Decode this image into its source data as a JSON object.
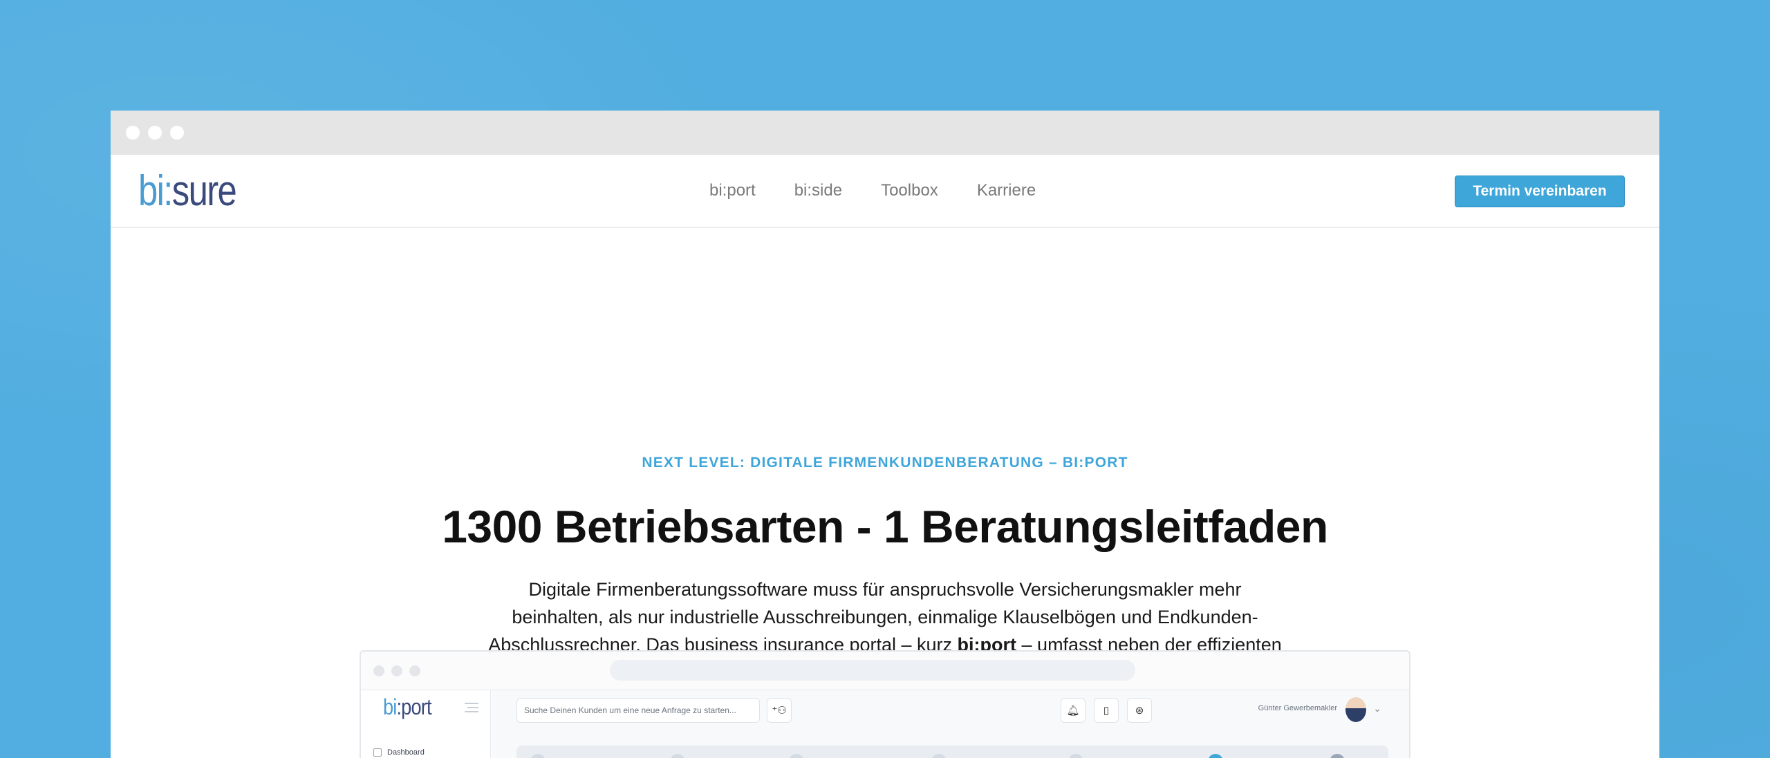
{
  "header": {
    "logo": {
      "bi": "bi",
      "colon": ":",
      "sure": "sure"
    },
    "nav": [
      "bi:port",
      "bi:side",
      "Toolbox",
      "Karriere"
    ],
    "cta_label": "Termin vereinbaren"
  },
  "hero": {
    "eyebrow": "NEXT LEVEL: DIGITALE FIRMENKUNDENBERATUNG – BI:PORT",
    "headline": "1300 Betriebsarten - 1 Beratungsleitfaden",
    "desc_before": "Digitale Firmenberatungssoftware muss für anspruchsvolle Versicherungsmakler mehr beinhalten, als nur industrielle Ausschreibungen, einmalige Klauselbögen und Endkunden-Abschlussrechner. Das business insurance portal – kurz ",
    "desc_bold": "bi:port",
    "desc_after": " – umfasst neben der effizienten Neukunden-Gewinnung, die wichtige Aufbereitung der Bestandsdaten, die den Cross-Selling Aufwand auf wenige Knopfdrücke reduziert."
  },
  "app_preview": {
    "logo": {
      "bi": "bi",
      "port": ":port"
    },
    "sidebar_item": "Dashboard",
    "search_placeholder": "Suche Deinen Kunden um eine neue Anfrage zu starten...",
    "user_name": "Günter Gewerbemakler",
    "icons": [
      "add-user-icon",
      "bell-icon",
      "book-icon",
      "help-icon"
    ]
  },
  "colors": {
    "background": "#52aee0",
    "accent": "#3fa6da",
    "logo_dark": "#3a4a7c"
  }
}
